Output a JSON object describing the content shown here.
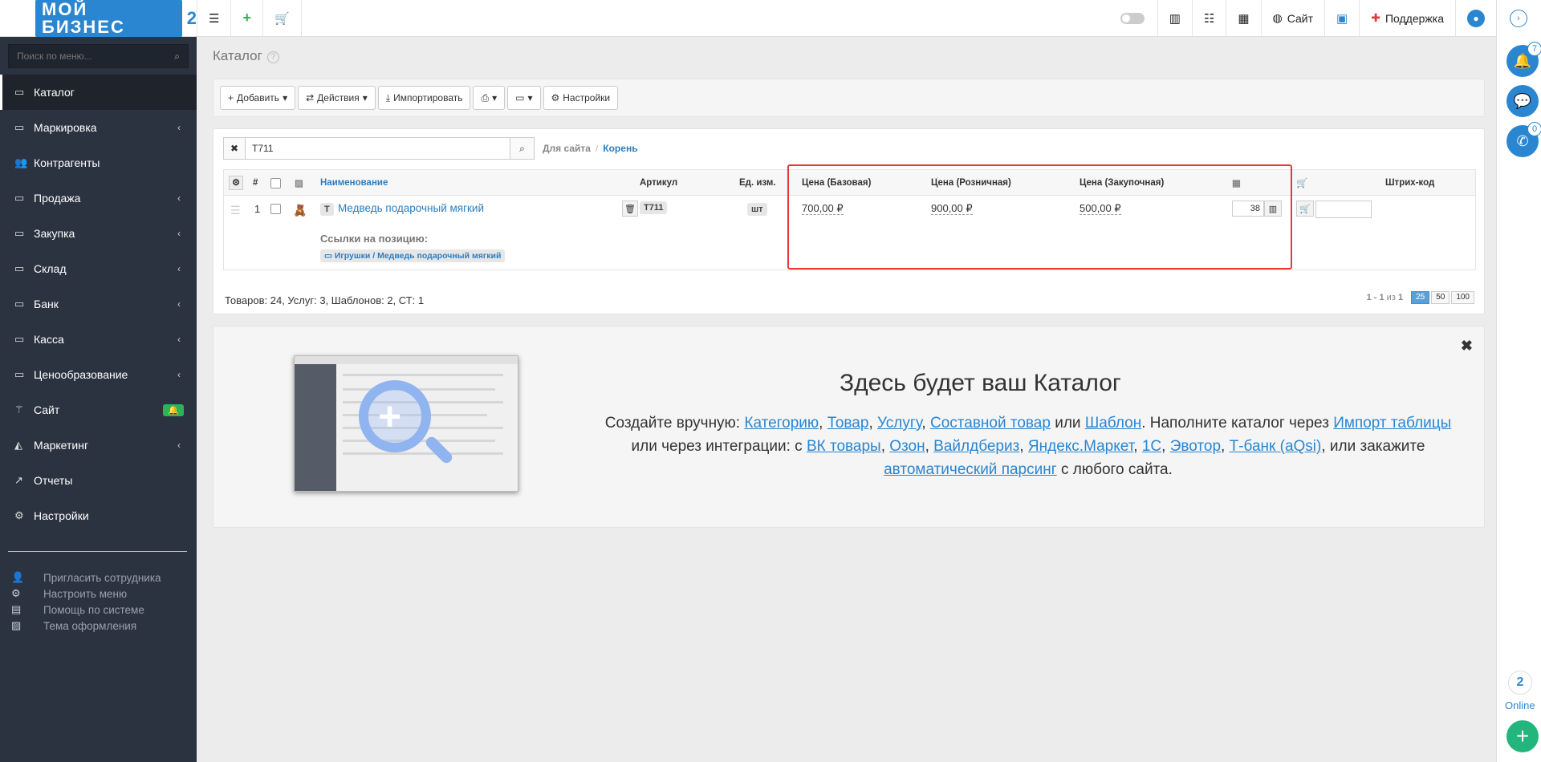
{
  "logo": {
    "text": "МОЙ БИЗНЕС",
    "num": "2"
  },
  "topbar": {
    "site_label": "Сайт",
    "support_label": "Поддержка"
  },
  "sidebar": {
    "search_placeholder": "Поиск по меню...",
    "items": [
      {
        "label": "Каталог",
        "icon": "folder-icon"
      },
      {
        "label": "Маркировка",
        "icon": "folder-icon"
      },
      {
        "label": "Контрагенты",
        "icon": "users-icon"
      },
      {
        "label": "Продажа",
        "icon": "folder-icon"
      },
      {
        "label": "Закупка",
        "icon": "folder-icon"
      },
      {
        "label": "Склад",
        "icon": "folder-icon"
      },
      {
        "label": "Банк",
        "icon": "folder-icon"
      },
      {
        "label": "Касса",
        "icon": "folder-icon"
      },
      {
        "label": "Ценообразование",
        "icon": "folder-icon"
      },
      {
        "label": "Сайт",
        "icon": "magic-wand-icon"
      },
      {
        "label": "Маркетинг",
        "icon": "chart-area-icon"
      },
      {
        "label": "Отчеты",
        "icon": "chart-line-icon"
      },
      {
        "label": "Настройки",
        "icon": "gear-icon"
      }
    ],
    "sub_items": [
      {
        "label": "Пригласить сотрудника",
        "icon": "user-plus-icon"
      },
      {
        "label": "Настроить меню",
        "icon": "gears-icon"
      },
      {
        "label": "Помощь по системе",
        "icon": "book-icon"
      },
      {
        "label": "Тема оформления",
        "icon": "image-icon"
      }
    ]
  },
  "rail": {
    "notifications_count": "7",
    "calls_count": "0",
    "online_count": "2",
    "online_label": "Online"
  },
  "page": {
    "title": "Каталог"
  },
  "toolbar": {
    "add": "Добавить",
    "actions": "Действия",
    "import": "Импортировать",
    "settings": "Настройки"
  },
  "filter": {
    "value": "T711",
    "crumb_site": "Для сайта",
    "crumb_root": "Корень"
  },
  "table": {
    "headers": {
      "num": "#",
      "name": "Наименование",
      "article": "Артикул",
      "unit": "Ед. изм.",
      "price_base": "Цена (Базовая)",
      "price_retail": "Цена (Розничная)",
      "price_purchase": "Цена (Закупочная)",
      "barcode": "Штрих-код"
    },
    "row": {
      "num": "1",
      "type": "Т",
      "name": "Медведь подарочный мягкий",
      "article": "T711",
      "unit": "шт",
      "price_base": "700,00 ₽",
      "price_retail": "900,00 ₽",
      "price_purchase": "500,00 ₽",
      "qty": "38",
      "links_title": "Ссылки на позицию:",
      "link_path": "Игрушки / Медведь подарочный мягкий"
    }
  },
  "stats": "Товаров: 24, Услуг: 3, Шаблонов: 2, СТ: 1",
  "pager": {
    "range": "1 - 1",
    "of": "из",
    "total": "1",
    "sizes": [
      "25",
      "50",
      "100"
    ],
    "active": "25"
  },
  "promo": {
    "title": "Здесь будет ваш Каталог",
    "t1": "Создайте вручную: ",
    "l_category": "Категорию",
    "c1": ", ",
    "l_product": "Товар",
    "c2": ", ",
    "l_service": "Услугу",
    "c3": ", ",
    "l_composite": "Составной товар",
    "t2": " или ",
    "l_template": "Шаблон",
    "t3": ". Наполните каталог через ",
    "l_import": "Импорт таблицы",
    "t4": " или через интеграции: с ",
    "l_vk": "ВК товары",
    "c4": ", ",
    "l_ozon": "Озон",
    "c5": ", ",
    "l_wb": "Вайлдбериз",
    "c6": ", ",
    "l_ym": "Яндекс.Маркет",
    "c7": ", ",
    "l_1c": "1С",
    "c8": ", ",
    "l_evotor": "Эвотор",
    "c9": ", ",
    "l_tbank": "Т-банк (aQsi)",
    "t5": ", или закажите ",
    "l_parsing": "автоматический парсинг",
    "t6": " с любого сайта."
  },
  "colors": {
    "accent": "#2a86d1",
    "sidebar": "#2c3340",
    "highlight": "#e53935",
    "online_plus": "#22b67d"
  }
}
